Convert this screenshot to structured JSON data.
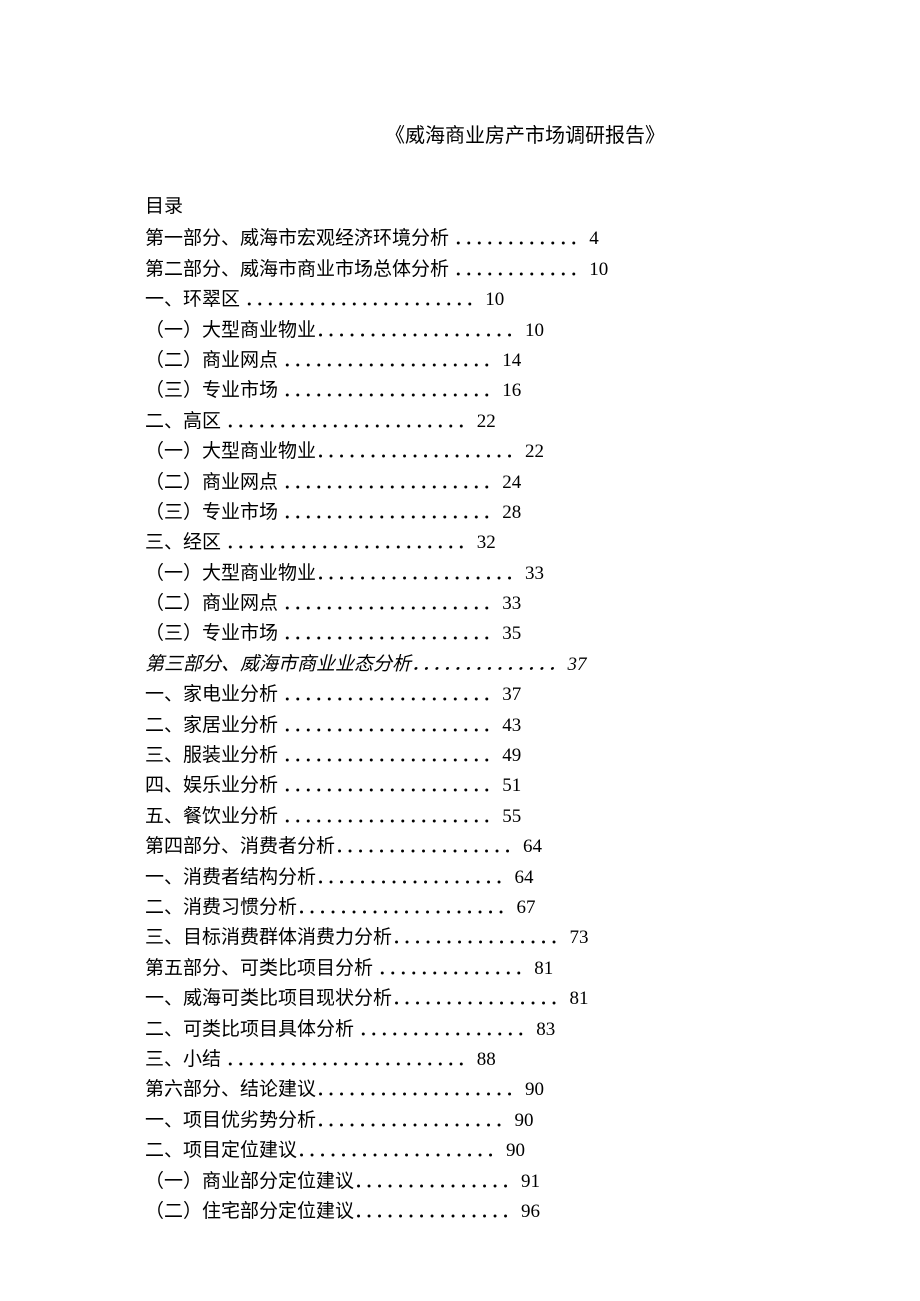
{
  "title": "《威海商业房产市场调研报告》",
  "toc_heading": "目录",
  "items": [
    {
      "label": "第一部分、威海市宏观经济环境分析 ",
      "dots": "．．．．．．．．．．．．",
      "page": "4",
      "italic": false
    },
    {
      "label": "第二部分、威海市商业市场总体分析 ",
      "dots": "．．．．．．．．．．．．",
      "page": "10",
      "italic": false
    },
    {
      "label": "一、环翠区 ",
      "dots": "．．．．．．．．．．．．．．．．．．．．．．",
      "page": "10",
      "italic": false
    },
    {
      "label": "（一）大型商业物业",
      "dots": "．．．．．．．．．．．．．．．．．．．",
      "page": "10",
      "italic": false
    },
    {
      "label": "（二）商业网点 ",
      "dots": "．．．．．．．．．．．．．．．．．．．．",
      "page": "14",
      "italic": false
    },
    {
      "label": "（三）专业市场 ",
      "dots": "．．．．．．．．．．．．．．．．．．．．",
      "page": "16",
      "italic": false
    },
    {
      "label": "二、高区 ",
      "dots": "．．．．．．．．．．．．．．．．．．．．．．．",
      "page": "22",
      "italic": false
    },
    {
      "label": "（一）大型商业物业",
      "dots": "．．．．．．．．．．．．．．．．．．．",
      "page": "22",
      "italic": false
    },
    {
      "label": "（二）商业网点 ",
      "dots": "．．．．．．．．．．．．．．．．．．．．",
      "page": "24",
      "italic": false
    },
    {
      "label": "（三）专业市场 ",
      "dots": "．．．．．．．．．．．．．．．．．．．．",
      "page": "28",
      "italic": false
    },
    {
      "label": "三、经区 ",
      "dots": "．．．．．．．．．．．．．．．．．．．．．．．",
      "page": "32",
      "italic": false
    },
    {
      "label": "（一）大型商业物业",
      "dots": "．．．．．．．．．．．．．．．．．．．",
      "page": "33",
      "italic": false
    },
    {
      "label": "（二）商业网点 ",
      "dots": "．．．．．．．．．．．．．．．．．．．．",
      "page": "33",
      "italic": false
    },
    {
      "label": "（三）专业市场 ",
      "dots": "．．．．．．．．．．．．．．．．．．．．",
      "page": "35",
      "italic": false
    },
    {
      "label": "第三部分、威海市商业业态分析",
      "dots": "．．．．．．．．．．．．．．",
      "page": "37",
      "italic": true
    },
    {
      "label": "一、家电业分析 ",
      "dots": "．．．．．．．．．．．．．．．．．．．．",
      "page": "37",
      "italic": false
    },
    {
      "label": "二、家居业分析 ",
      "dots": "．．．．．．．．．．．．．．．．．．．．",
      "page": "43",
      "italic": false
    },
    {
      "label": "三、服装业分析 ",
      "dots": "．．．．．．．．．．．．．．．．．．．．",
      "page": "49",
      "italic": false
    },
    {
      "label": "四、娱乐业分析 ",
      "dots": "．．．．．．．．．．．．．．．．．．．．",
      "page": "51",
      "italic": false
    },
    {
      "label": "五、餐饮业分析 ",
      "dots": "．．．．．．．．．．．．．．．．．．．．",
      "page": "55",
      "italic": false
    },
    {
      "label": "第四部分、消费者分析",
      "dots": "．．．．．．．．．．．．．．．．．",
      "page": "64",
      "italic": false
    },
    {
      "label": "一、消费者结构分析",
      "dots": "．．．．．．．．．．．．．．．．．．",
      "page": "64",
      "italic": false
    },
    {
      "label": "二、消费习惯分析",
      "dots": "．．．．．．．．．．．．．．．．．．．．",
      "page": "67",
      "italic": false
    },
    {
      "label": "三、目标消费群体消费力分析",
      "dots": "．．．．．．．．．．．．．．．．",
      "page": "73",
      "italic": false
    },
    {
      "label": "第五部分、可类比项目分析 ",
      "dots": "．．．．．．．．．．．．．．",
      "page": "81",
      "italic": false
    },
    {
      "label": "一、威海可类比项目现状分析",
      "dots": "．．．．．．．．．．．．．．．．",
      "page": "81",
      "italic": false
    },
    {
      "label": "二、可类比项目具体分析 ",
      "dots": "．．．．．．．．．．．．．．．．",
      "page": "83",
      "italic": false
    },
    {
      "label": "三、小结 ",
      "dots": "．．．．．．．．．．．．．．．．．．．．．．．",
      "page": "88",
      "italic": false
    },
    {
      "label": "第六部分、结论建议",
      "dots": "．．．．．．．．．．．．．．．．．．．",
      "page": "90",
      "italic": false
    },
    {
      "label": "一、项目优劣势分析",
      "dots": "．．．．．．．．．．．．．．．．．．",
      "page": "90",
      "italic": false
    },
    {
      "label": "二、项目定位建议",
      "dots": "．．．．．．．．．．．．．．．．．．．",
      "page": "90",
      "italic": false
    },
    {
      "label": "（一）商业部分定位建议",
      "dots": "．．．．．．．．．．．．．．．",
      "page": "91",
      "italic": false
    },
    {
      "label": "（二）住宅部分定位建议",
      "dots": "．．．．．．．．．．．．．．．",
      "page": "96",
      "italic": false
    }
  ]
}
